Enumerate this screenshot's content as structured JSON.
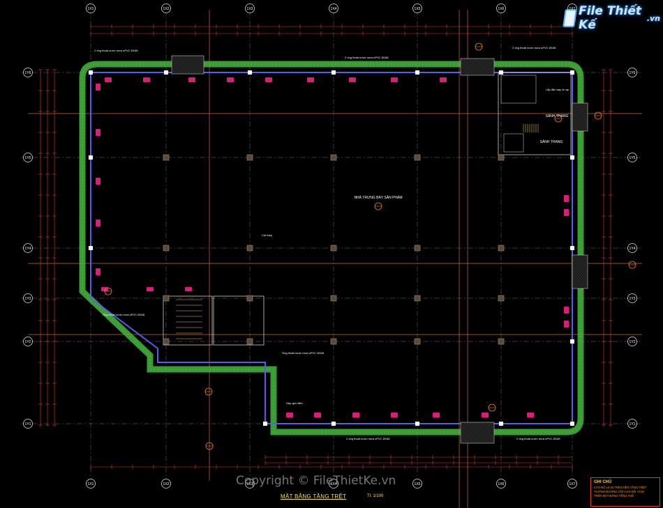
{
  "watermark": {
    "logo_text": "File Thiết Kế",
    "logo_suffix": ".vn",
    "copyright": "Copyright © FileThietKe.vn"
  },
  "drawing": {
    "title": "MẶT BẰNG TẦNG TRỆT",
    "scale": "Tl: 1/100",
    "room_main": "NHÀ TRƯNG BÀY SẢN PHẨM",
    "stair_hall_1": "SẢNH THANG",
    "stair_hall_2": "SẢNH THANG",
    "pipe_label_top_left": "2 ống thoát nước mưa uPVC Ø168",
    "pipe_label_top_mid": "2 ống thoát nước mưa uPVC Ø168",
    "pipe_label_top_right": "2 ống thoát nước mưa uPVC Ø168",
    "pipe_label_left": "Ống thoát nước mưa uPVC Ø168",
    "pipe_label_mid": "Ống thoát nước mưa uPVC Ø168",
    "pipe_label_bottom_mid": "2 ống thoát nước mưa uPVC Ø168",
    "pipe_label_bottom_right": "2 ống thoát nước mưa uPVC Ø168",
    "box_elec": "Hộp gen điện",
    "col_label": "Cột thép",
    "equip_note": "Lắp đặt máy ốn áp",
    "grid_cols": [
      "1X1",
      "1X2",
      "1X3",
      "1X4",
      "1X5",
      "1X6",
      "1X7"
    ],
    "grid_rows": [
      "1Y6",
      "1Y5",
      "1Y4",
      "1Y3",
      "1Y2",
      "1Y1"
    ]
  },
  "notes": {
    "heading": "GHI CHÚ",
    "lines": [
      "CAO ĐỘ ±0.00 TRÊN NỀN TẦNG TRỆT",
      "TƯƠNG ĐƯƠNG VỚI CAO ĐỘ +0.50",
      "TRÊN MẶT BẰNG TỔNG THỂ"
    ]
  },
  "colors": {
    "background": "#000000",
    "wall_green": "#3fae3a",
    "wall_blue": "#5a5cf0",
    "dim_red": "#e23b2b",
    "grid_orange": "#f07f2e",
    "text_yellow": "#f3e24a",
    "marker_magenta": "#e0197c",
    "grid_white": "#cfcfcf"
  }
}
